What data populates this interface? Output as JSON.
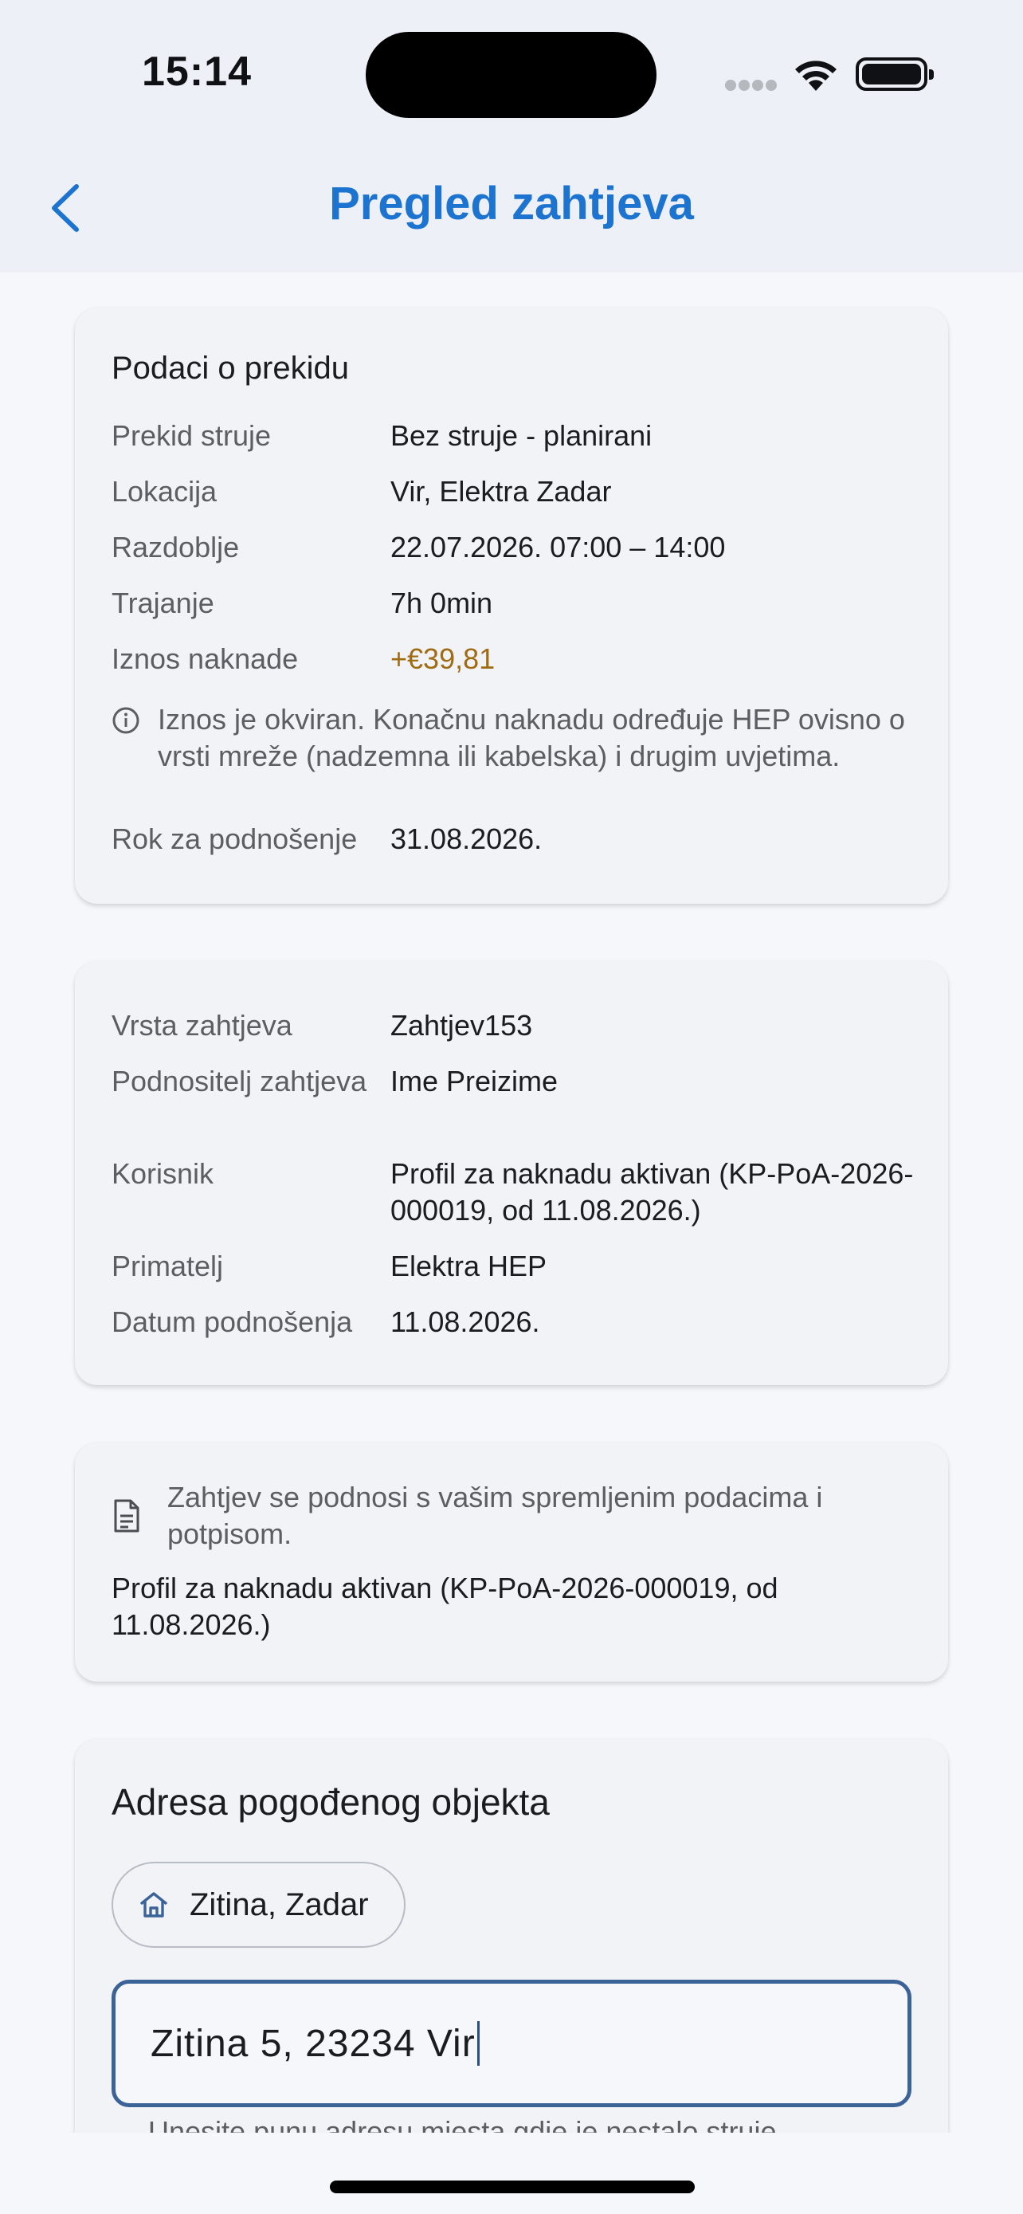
{
  "status_bar": {
    "time": "15:14"
  },
  "header": {
    "title": "Pregled zahtjeva"
  },
  "outage_card": {
    "title": "Podaci o prekidu",
    "rows": [
      {
        "label": "Prekid struje",
        "value": "Bez struje - planirani"
      },
      {
        "label": "Lokacija",
        "value": "Vir, Elektra Zadar"
      },
      {
        "label": "Razdoblje",
        "value": "22.07.2026. 07:00 – 14:00"
      },
      {
        "label": "Trajanje",
        "value": "7h 0min"
      },
      {
        "label": "Iznos naknade",
        "value": "+€39,81"
      }
    ],
    "note": "Iznos je okviran. Konačnu naknadu određuje HEP ovisno o vrsti mreže (nadzemna ili kabelska) i drugim uvjetima.",
    "deadline": {
      "label": "Rok za podnošenje",
      "value": "31.08.2026."
    },
    "amount_color": "#a06c13"
  },
  "request_card": {
    "rows": [
      {
        "label": "Vrsta zahtjeva",
        "value": "Zahtjev153"
      },
      {
        "label": "Podnositelj zahtjeva",
        "value": "Ime Preizime"
      },
      {
        "label": "Korisnik",
        "value": "Profil za naknadu aktivan (KP-PoA-2026-000019, od 11.08.2026.)"
      },
      {
        "label": "Primatelj",
        "value": "Elektra HEP"
      },
      {
        "label": "Datum podnošenja",
        "value": "11.08.2026."
      }
    ]
  },
  "signature_card": {
    "note": "Zahtjev se podnosi s vašim spremljenim podacima i potpisom.",
    "profile": "Profil za naknadu aktivan (KP-PoA-2026-000019, od 11.08.2026.)"
  },
  "address_card": {
    "title": "Adresa pogođenog objekta",
    "chip_label": "Zitina, Zadar",
    "input_value": "Zitina 5, 23234 Vir",
    "helper": "Unesite punu adresu mjesta gdje je nestalo struje"
  },
  "colors": {
    "accent": "#1d74d0",
    "input_border": "#3b6398"
  }
}
